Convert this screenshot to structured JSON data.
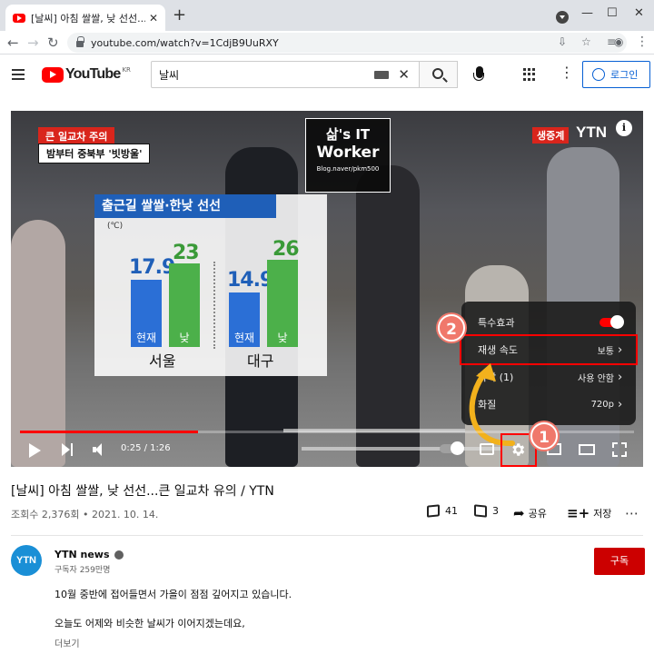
{
  "browser": {
    "tab_title": "[날씨] 아침 쌀쌀, 낮 선선...큰 일교차 유...",
    "tab_close": "✕",
    "new_tab": "+",
    "url": "youtube.com/watch?v=1CdjB9UuRXY",
    "minimize": "—",
    "maximize": "☐",
    "close": "✕"
  },
  "youtube": {
    "logo_text": "YouTube",
    "logo_region": "KR",
    "search_value": "날씨",
    "login_label": "로그인"
  },
  "video": {
    "overlay": {
      "top_tag": "큰 일교차 주의",
      "sub_tag": "밤부터 중북부 '빗방울'",
      "watermark_line1": "삶's IT",
      "watermark_line2": "Worker",
      "watermark_line3": "Blog.naver/pkm500",
      "live_label": "생중계",
      "channel_logo": "YTN",
      "info_label": "i"
    },
    "weather_graphic": {
      "title": "출근길 쌀쌀·한낮 선선",
      "unit": "(℃)",
      "cities": [
        {
          "name": "서울",
          "now_label": "현재",
          "now_value": "17.9",
          "day_label": "낮",
          "day_value": "23"
        },
        {
          "name": "대구",
          "now_label": "현재",
          "now_value": "14.9",
          "day_label": "낮",
          "day_value": "26"
        }
      ]
    },
    "player": {
      "time": "0:25 / 1:26",
      "progress": 0.29
    },
    "settings_menu": {
      "items": [
        {
          "label": "특수효과",
          "value": ""
        },
        {
          "label": "재생 속도",
          "value": "보통"
        },
        {
          "label": "자막 (1)",
          "value": "사용 안함"
        },
        {
          "label": "화질",
          "value": "720p"
        }
      ]
    },
    "annotations": {
      "step1": "1",
      "step2": "2",
      "highlight_color": "#ff0000",
      "badge_color": "#f0786b",
      "arrow_color": "#f2b11c"
    }
  },
  "meta": {
    "title": "[날씨] 아침 쌀쌀, 낮 선선...큰 일교차 유의 / YTN",
    "stats": "조회수 2,376회 • 2021. 10. 14.",
    "likes": "41",
    "dislikes": "3",
    "share_label": "공유",
    "save_label": "저장",
    "more": "⋯"
  },
  "channel": {
    "avatar_text": "YTN",
    "name": "YTN news",
    "subscribers": "구독자 259만명",
    "subscribe_label": "구독",
    "description": [
      "10월 중반에 접어들면서 가을이 점점 깊어지고 있습니다.",
      "오늘도 어제와 비슷한 날씨가 이어지겠는데요,"
    ],
    "more_label": "더보기"
  }
}
